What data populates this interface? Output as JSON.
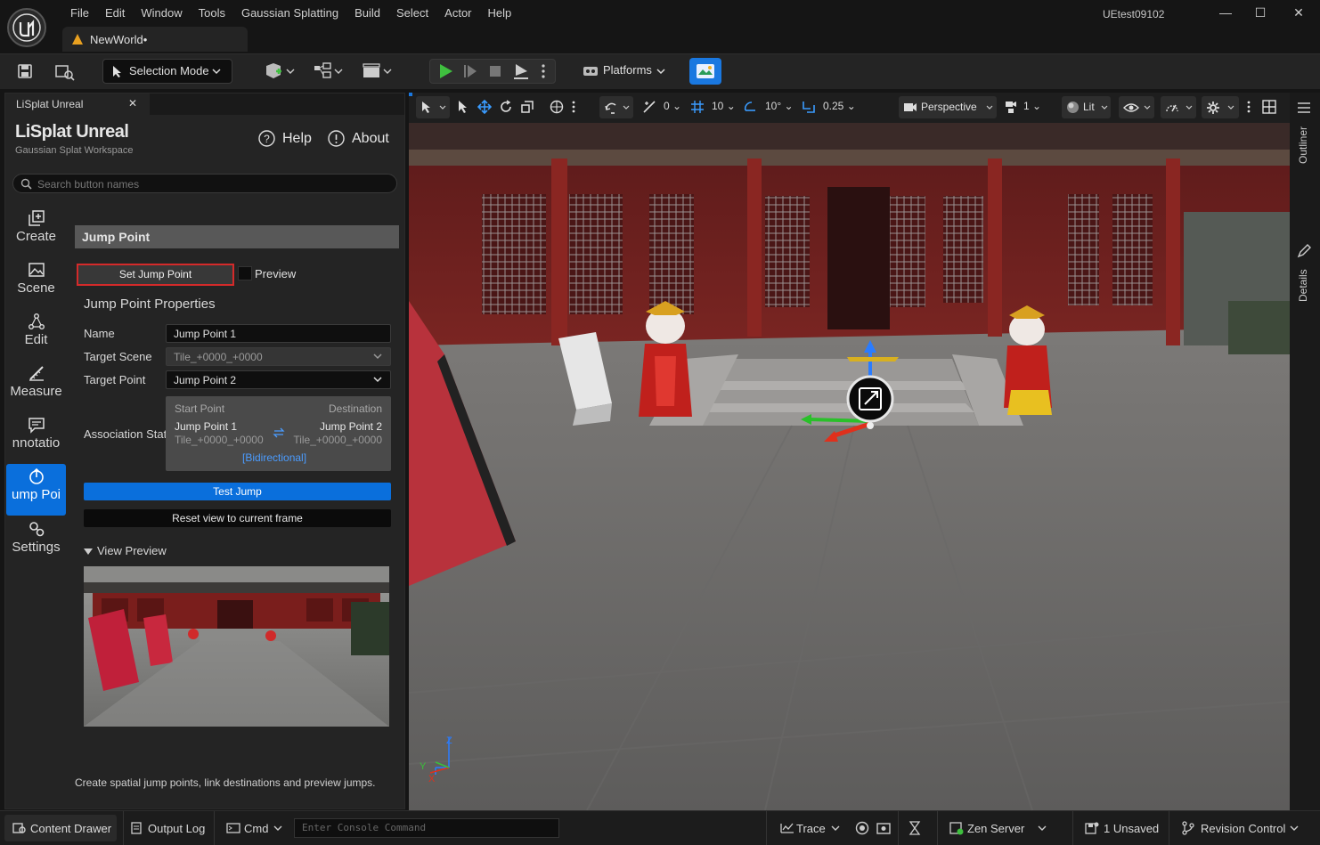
{
  "window": {
    "title": "UEtest09102",
    "document_tab": "NewWorld•",
    "menu": [
      "File",
      "Edit",
      "Window",
      "Tools",
      "Gaussian Splatting",
      "Build",
      "Select",
      "Actor",
      "Help"
    ]
  },
  "toolbar": {
    "selection_mode": "Selection Mode",
    "platforms": "Platforms"
  },
  "panel": {
    "tab_label": "LiSplat Unreal",
    "app_title": "LiSplat Unreal",
    "app_subtitle": "Gaussian Splat Workspace",
    "help": "Help",
    "about": "About",
    "search_placeholder": "Search button names",
    "nav": [
      {
        "label": "Create",
        "icon": "create-icon"
      },
      {
        "label": "Scene",
        "icon": "image-icon"
      },
      {
        "label": "Edit",
        "icon": "nodes-icon"
      },
      {
        "label": "Measure",
        "icon": "ruler-icon"
      },
      {
        "label": "nnotatio",
        "icon": "comment-icon"
      },
      {
        "label": "ump Poi",
        "icon": "jump-point-icon",
        "active": true
      },
      {
        "label": "Settings",
        "icon": "settings-icon"
      }
    ],
    "section_title": "Jump Point",
    "set_jump_point": "Set Jump Point",
    "preview_label": "Preview",
    "properties_title": "Jump Point Properties",
    "props": {
      "name_label": "Name",
      "name_value": "Jump Point 1",
      "scene_label": "Target Scene",
      "scene_value": "Tile_+0000_+0000",
      "point_label": "Target Point",
      "point_value": "Jump Point 2",
      "assoc_label": "Association Stat"
    },
    "association": {
      "start_header": "Start Point",
      "dest_header": "Destination",
      "start_name": "Jump Point 1",
      "start_tile": "Tile_+0000_+0000",
      "dest_name": "Jump Point 2",
      "dest_tile": "Tile_+0000_+0000",
      "mode": "[Bidirectional]"
    },
    "test_jump": "Test Jump",
    "reset_view": "Reset view to current frame",
    "view_preview": "View Preview",
    "footnote": "Create spatial jump points, link destinations and preview jumps."
  },
  "viewport_toolbar": {
    "rotate_snap": "0",
    "grid_snap": "10",
    "angle_snap": "10°",
    "scale_snap": "0.25",
    "view_mode": "Perspective",
    "camera_speed": "1",
    "lighting": "Lit"
  },
  "right_tabs": [
    "Outliner",
    "Details"
  ],
  "statusbar": {
    "content_drawer": "Content Drawer",
    "output_log": "Output Log",
    "cmd": "Cmd",
    "console_placeholder": "Enter Console Command",
    "trace": "Trace",
    "zen_server": "Zen Server",
    "unsaved": "1 Unsaved",
    "revision_control": "Revision Control"
  },
  "colors": {
    "accent": "#0a6fdc",
    "play": "#3fbf3f",
    "highlight_border": "#d42a2a"
  }
}
